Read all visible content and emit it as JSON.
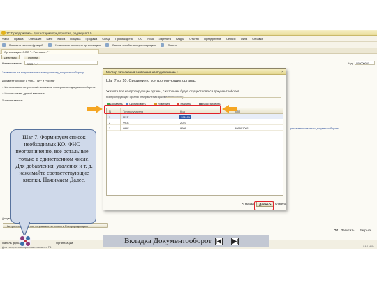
{
  "window": {
    "title": "1С:Предприятие - Бухгалтерия предприятия, редакция 2.0"
  },
  "menu": [
    "Файл",
    "Правка",
    "Операции",
    "Банк",
    "Касса",
    "Покупка",
    "Продажа",
    "Склад",
    "Производство",
    "ОС",
    "НМА",
    "Зарплата",
    "Кадры",
    "Отчеты",
    "Предприятие",
    "Сервис",
    "Окна",
    "Справка"
  ],
  "toolbar": {
    "items": [
      "Показать панель функций",
      "Установить основную организацию",
      "Ввести хозяйственную операцию",
      "Советы"
    ]
  },
  "tabbar": {
    "tab": "Организации: ООО \"...Тестовая...\" *"
  },
  "form": {
    "actions": "Действия",
    "goto": "Перейти",
    "name_label": "Наименование:",
    "name_value": "ООО \"...\"",
    "code_label": "Код:",
    "code_value": "000000001",
    "link_app": "Заявление на подключение к электронному документообороту",
    "doc_section": "Документооборот с ФНС, ПФР и Росстат",
    "opt_builtin": "Использовать встроенный механизм электронного документооборота",
    "opt_other": "Использовать другой механизм",
    "account_label": "Учетная запись:",
    "settings_btn": "Настроить параметры отправки отчетности в Росприроднадзор",
    "side_note": "...регламентированного документооборота"
  },
  "dialog": {
    "title": "Мастер заполнения заявления на подключение *",
    "close": "×",
    "step": "Шаг 7 из 10: Сведения о контролирующих органах",
    "hint": "Укажите все контролирующие органы, с которыми будет осуществляться документооборот",
    "section": "Контролирующие органы (направления документооборота)",
    "toolbar": {
      "add": "Добавить",
      "copy": "Скопировать",
      "edit": "Изменить",
      "delete": "Удалить",
      "restore": "Восстановить"
    },
    "table": {
      "headers": [
        "N",
        "Тип получателя",
        "Код",
        "КПП"
      ],
      "rows": [
        {
          "n": "1",
          "type": "ПФР",
          "code": "101101",
          "kpp": ""
        },
        {
          "n": "2",
          "type": "ФСС",
          "code": "2023",
          "kpp": ""
        },
        {
          "n": "3",
          "type": "ФНС",
          "code": "9999",
          "kpp": "999901001"
        }
      ]
    },
    "footer": {
      "back": "< Назад",
      "next": "Далее >",
      "cancel": "Отмена"
    }
  },
  "statusbar": {
    "panel": "Панель функций",
    "orgs": "Организации",
    "hint": "Для получения подсказки нажмите F1",
    "ok": "ОК",
    "save": "Записать",
    "close": "Закрыть",
    "caps": "CAP",
    "num": "NUM"
  },
  "callout": {
    "text": "Шаг 7. Формируем список необходимых КО. ФНС – неограниченно, все остальные – только в единственном числе. Для добавления, удаления и т. д. нажимайте соответствующие кнопки. Нажимаем Далее."
  },
  "footer": {
    "title": "Вкладка Документооборот",
    "prev": "previous-arrow",
    "next": "next-arrow"
  },
  "colors": {
    "highlight": "#e0222a",
    "arrow": "#f5a623",
    "callout_bg": "#cfd9ea",
    "selection": "#2f5aa8"
  }
}
